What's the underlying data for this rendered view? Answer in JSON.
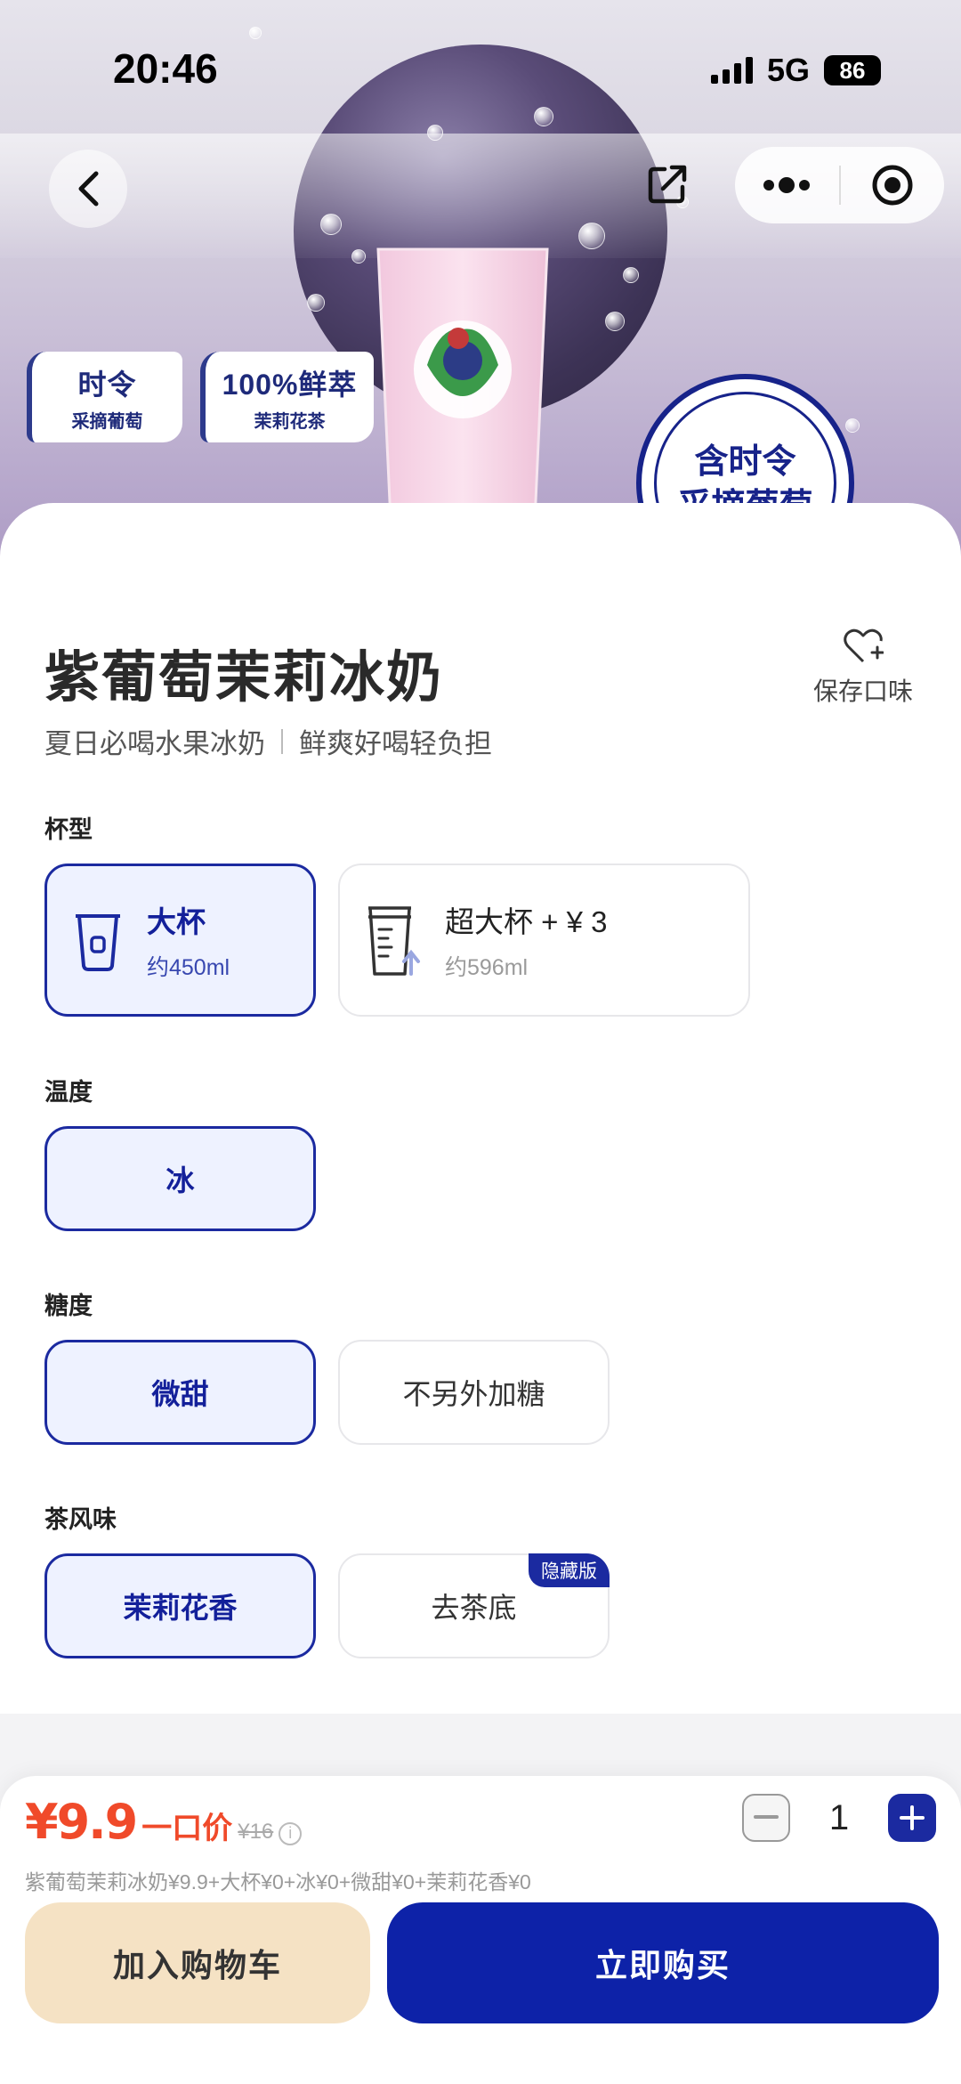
{
  "status": {
    "time": "20:46",
    "network": "5G",
    "battery": "86"
  },
  "hero": {
    "tag1": {
      "line1": "时令",
      "line2": "采摘葡萄"
    },
    "tag2": {
      "line1": "100%鲜萃",
      "line2": "茉莉花茶"
    },
    "stamp": {
      "line1": "含时令",
      "line2": "采摘葡萄"
    }
  },
  "product": {
    "title": "紫葡萄茉莉冰奶",
    "subtitle_a": "夏日必喝水果冰奶",
    "subtitle_b": "鲜爽好喝轻负担",
    "save_label": "保存口味"
  },
  "options": {
    "cup": {
      "label": "杯型",
      "items": [
        {
          "name": "大杯",
          "volume": "约450ml",
          "selected": true
        },
        {
          "name": "超大杯 + ¥ 3",
          "volume": "约596ml",
          "selected": false
        }
      ]
    },
    "temp": {
      "label": "温度",
      "items": [
        {
          "name": "冰",
          "selected": true
        }
      ]
    },
    "sugar": {
      "label": "糖度",
      "items": [
        {
          "name": "微甜",
          "selected": true
        },
        {
          "name": "不另外加糖",
          "selected": false
        }
      ]
    },
    "tea": {
      "label": "茶风味",
      "items": [
        {
          "name": "茉莉花香",
          "selected": true
        },
        {
          "name": "去茶底",
          "selected": false,
          "badge": "隐藏版"
        }
      ]
    }
  },
  "cart": {
    "price": "¥9.9",
    "price_tag": "一口价",
    "original": "¥16",
    "breakdown": "紫葡萄茉莉冰奶¥9.9+大杯¥0+冰¥0+微甜¥0+茉莉花香¥0",
    "quantity": "1",
    "add_to_cart": "加入购物车",
    "buy_now": "立即购买"
  },
  "colors": {
    "accent": "#0d22a8",
    "price": "#f04a2a",
    "cart_button": "#f5e2c4"
  }
}
